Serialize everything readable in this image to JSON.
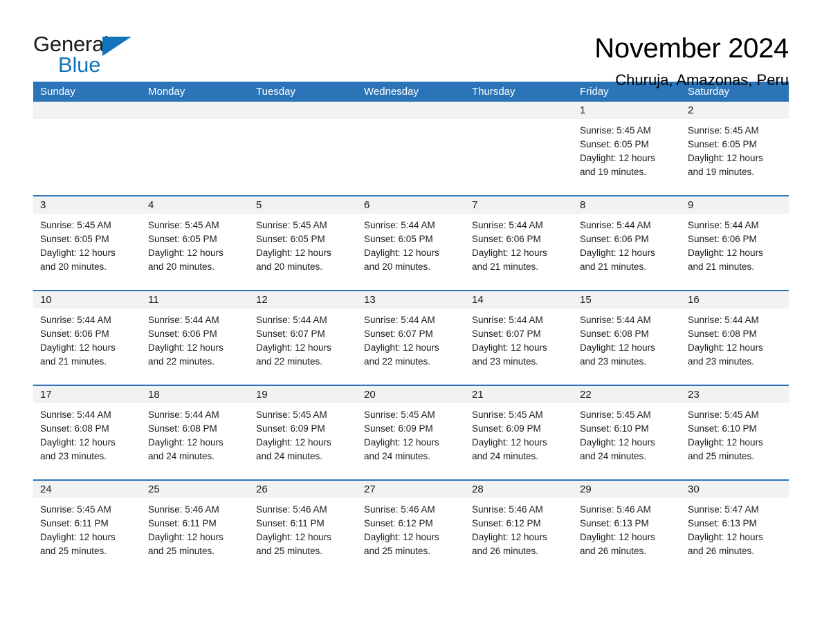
{
  "logo": {
    "word_one": "General",
    "word_two": "Blue",
    "triangle_color": "#1273ba"
  },
  "header": {
    "title": "November 2024",
    "subtitle": "Churuja, Amazonas, Peru"
  },
  "theme": {
    "header_blue": "#2b74b8",
    "day_band_gray": "#f2f2f2",
    "text_black": "#1a1a1a"
  },
  "calendar": {
    "weekdays": [
      "Sunday",
      "Monday",
      "Tuesday",
      "Wednesday",
      "Thursday",
      "Friday",
      "Saturday"
    ],
    "weeks": [
      [
        {
          "day": "",
          "lines": []
        },
        {
          "day": "",
          "lines": []
        },
        {
          "day": "",
          "lines": []
        },
        {
          "day": "",
          "lines": []
        },
        {
          "day": "",
          "lines": []
        },
        {
          "day": "1",
          "lines": [
            "Sunrise: 5:45 AM",
            "Sunset: 6:05 PM",
            "Daylight: 12 hours",
            "and 19 minutes."
          ]
        },
        {
          "day": "2",
          "lines": [
            "Sunrise: 5:45 AM",
            "Sunset: 6:05 PM",
            "Daylight: 12 hours",
            "and 19 minutes."
          ]
        }
      ],
      [
        {
          "day": "3",
          "lines": [
            "Sunrise: 5:45 AM",
            "Sunset: 6:05 PM",
            "Daylight: 12 hours",
            "and 20 minutes."
          ]
        },
        {
          "day": "4",
          "lines": [
            "Sunrise: 5:45 AM",
            "Sunset: 6:05 PM",
            "Daylight: 12 hours",
            "and 20 minutes."
          ]
        },
        {
          "day": "5",
          "lines": [
            "Sunrise: 5:45 AM",
            "Sunset: 6:05 PM",
            "Daylight: 12 hours",
            "and 20 minutes."
          ]
        },
        {
          "day": "6",
          "lines": [
            "Sunrise: 5:44 AM",
            "Sunset: 6:05 PM",
            "Daylight: 12 hours",
            "and 20 minutes."
          ]
        },
        {
          "day": "7",
          "lines": [
            "Sunrise: 5:44 AM",
            "Sunset: 6:06 PM",
            "Daylight: 12 hours",
            "and 21 minutes."
          ]
        },
        {
          "day": "8",
          "lines": [
            "Sunrise: 5:44 AM",
            "Sunset: 6:06 PM",
            "Daylight: 12 hours",
            "and 21 minutes."
          ]
        },
        {
          "day": "9",
          "lines": [
            "Sunrise: 5:44 AM",
            "Sunset: 6:06 PM",
            "Daylight: 12 hours",
            "and 21 minutes."
          ]
        }
      ],
      [
        {
          "day": "10",
          "lines": [
            "Sunrise: 5:44 AM",
            "Sunset: 6:06 PM",
            "Daylight: 12 hours",
            "and 21 minutes."
          ]
        },
        {
          "day": "11",
          "lines": [
            "Sunrise: 5:44 AM",
            "Sunset: 6:06 PM",
            "Daylight: 12 hours",
            "and 22 minutes."
          ]
        },
        {
          "day": "12",
          "lines": [
            "Sunrise: 5:44 AM",
            "Sunset: 6:07 PM",
            "Daylight: 12 hours",
            "and 22 minutes."
          ]
        },
        {
          "day": "13",
          "lines": [
            "Sunrise: 5:44 AM",
            "Sunset: 6:07 PM",
            "Daylight: 12 hours",
            "and 22 minutes."
          ]
        },
        {
          "day": "14",
          "lines": [
            "Sunrise: 5:44 AM",
            "Sunset: 6:07 PM",
            "Daylight: 12 hours",
            "and 23 minutes."
          ]
        },
        {
          "day": "15",
          "lines": [
            "Sunrise: 5:44 AM",
            "Sunset: 6:08 PM",
            "Daylight: 12 hours",
            "and 23 minutes."
          ]
        },
        {
          "day": "16",
          "lines": [
            "Sunrise: 5:44 AM",
            "Sunset: 6:08 PM",
            "Daylight: 12 hours",
            "and 23 minutes."
          ]
        }
      ],
      [
        {
          "day": "17",
          "lines": [
            "Sunrise: 5:44 AM",
            "Sunset: 6:08 PM",
            "Daylight: 12 hours",
            "and 23 minutes."
          ]
        },
        {
          "day": "18",
          "lines": [
            "Sunrise: 5:44 AM",
            "Sunset: 6:08 PM",
            "Daylight: 12 hours",
            "and 24 minutes."
          ]
        },
        {
          "day": "19",
          "lines": [
            "Sunrise: 5:45 AM",
            "Sunset: 6:09 PM",
            "Daylight: 12 hours",
            "and 24 minutes."
          ]
        },
        {
          "day": "20",
          "lines": [
            "Sunrise: 5:45 AM",
            "Sunset: 6:09 PM",
            "Daylight: 12 hours",
            "and 24 minutes."
          ]
        },
        {
          "day": "21",
          "lines": [
            "Sunrise: 5:45 AM",
            "Sunset: 6:09 PM",
            "Daylight: 12 hours",
            "and 24 minutes."
          ]
        },
        {
          "day": "22",
          "lines": [
            "Sunrise: 5:45 AM",
            "Sunset: 6:10 PM",
            "Daylight: 12 hours",
            "and 24 minutes."
          ]
        },
        {
          "day": "23",
          "lines": [
            "Sunrise: 5:45 AM",
            "Sunset: 6:10 PM",
            "Daylight: 12 hours",
            "and 25 minutes."
          ]
        }
      ],
      [
        {
          "day": "24",
          "lines": [
            "Sunrise: 5:45 AM",
            "Sunset: 6:11 PM",
            "Daylight: 12 hours",
            "and 25 minutes."
          ]
        },
        {
          "day": "25",
          "lines": [
            "Sunrise: 5:46 AM",
            "Sunset: 6:11 PM",
            "Daylight: 12 hours",
            "and 25 minutes."
          ]
        },
        {
          "day": "26",
          "lines": [
            "Sunrise: 5:46 AM",
            "Sunset: 6:11 PM",
            "Daylight: 12 hours",
            "and 25 minutes."
          ]
        },
        {
          "day": "27",
          "lines": [
            "Sunrise: 5:46 AM",
            "Sunset: 6:12 PM",
            "Daylight: 12 hours",
            "and 25 minutes."
          ]
        },
        {
          "day": "28",
          "lines": [
            "Sunrise: 5:46 AM",
            "Sunset: 6:12 PM",
            "Daylight: 12 hours",
            "and 26 minutes."
          ]
        },
        {
          "day": "29",
          "lines": [
            "Sunrise: 5:46 AM",
            "Sunset: 6:13 PM",
            "Daylight: 12 hours",
            "and 26 minutes."
          ]
        },
        {
          "day": "30",
          "lines": [
            "Sunrise: 5:47 AM",
            "Sunset: 6:13 PM",
            "Daylight: 12 hours",
            "and 26 minutes."
          ]
        }
      ]
    ]
  }
}
